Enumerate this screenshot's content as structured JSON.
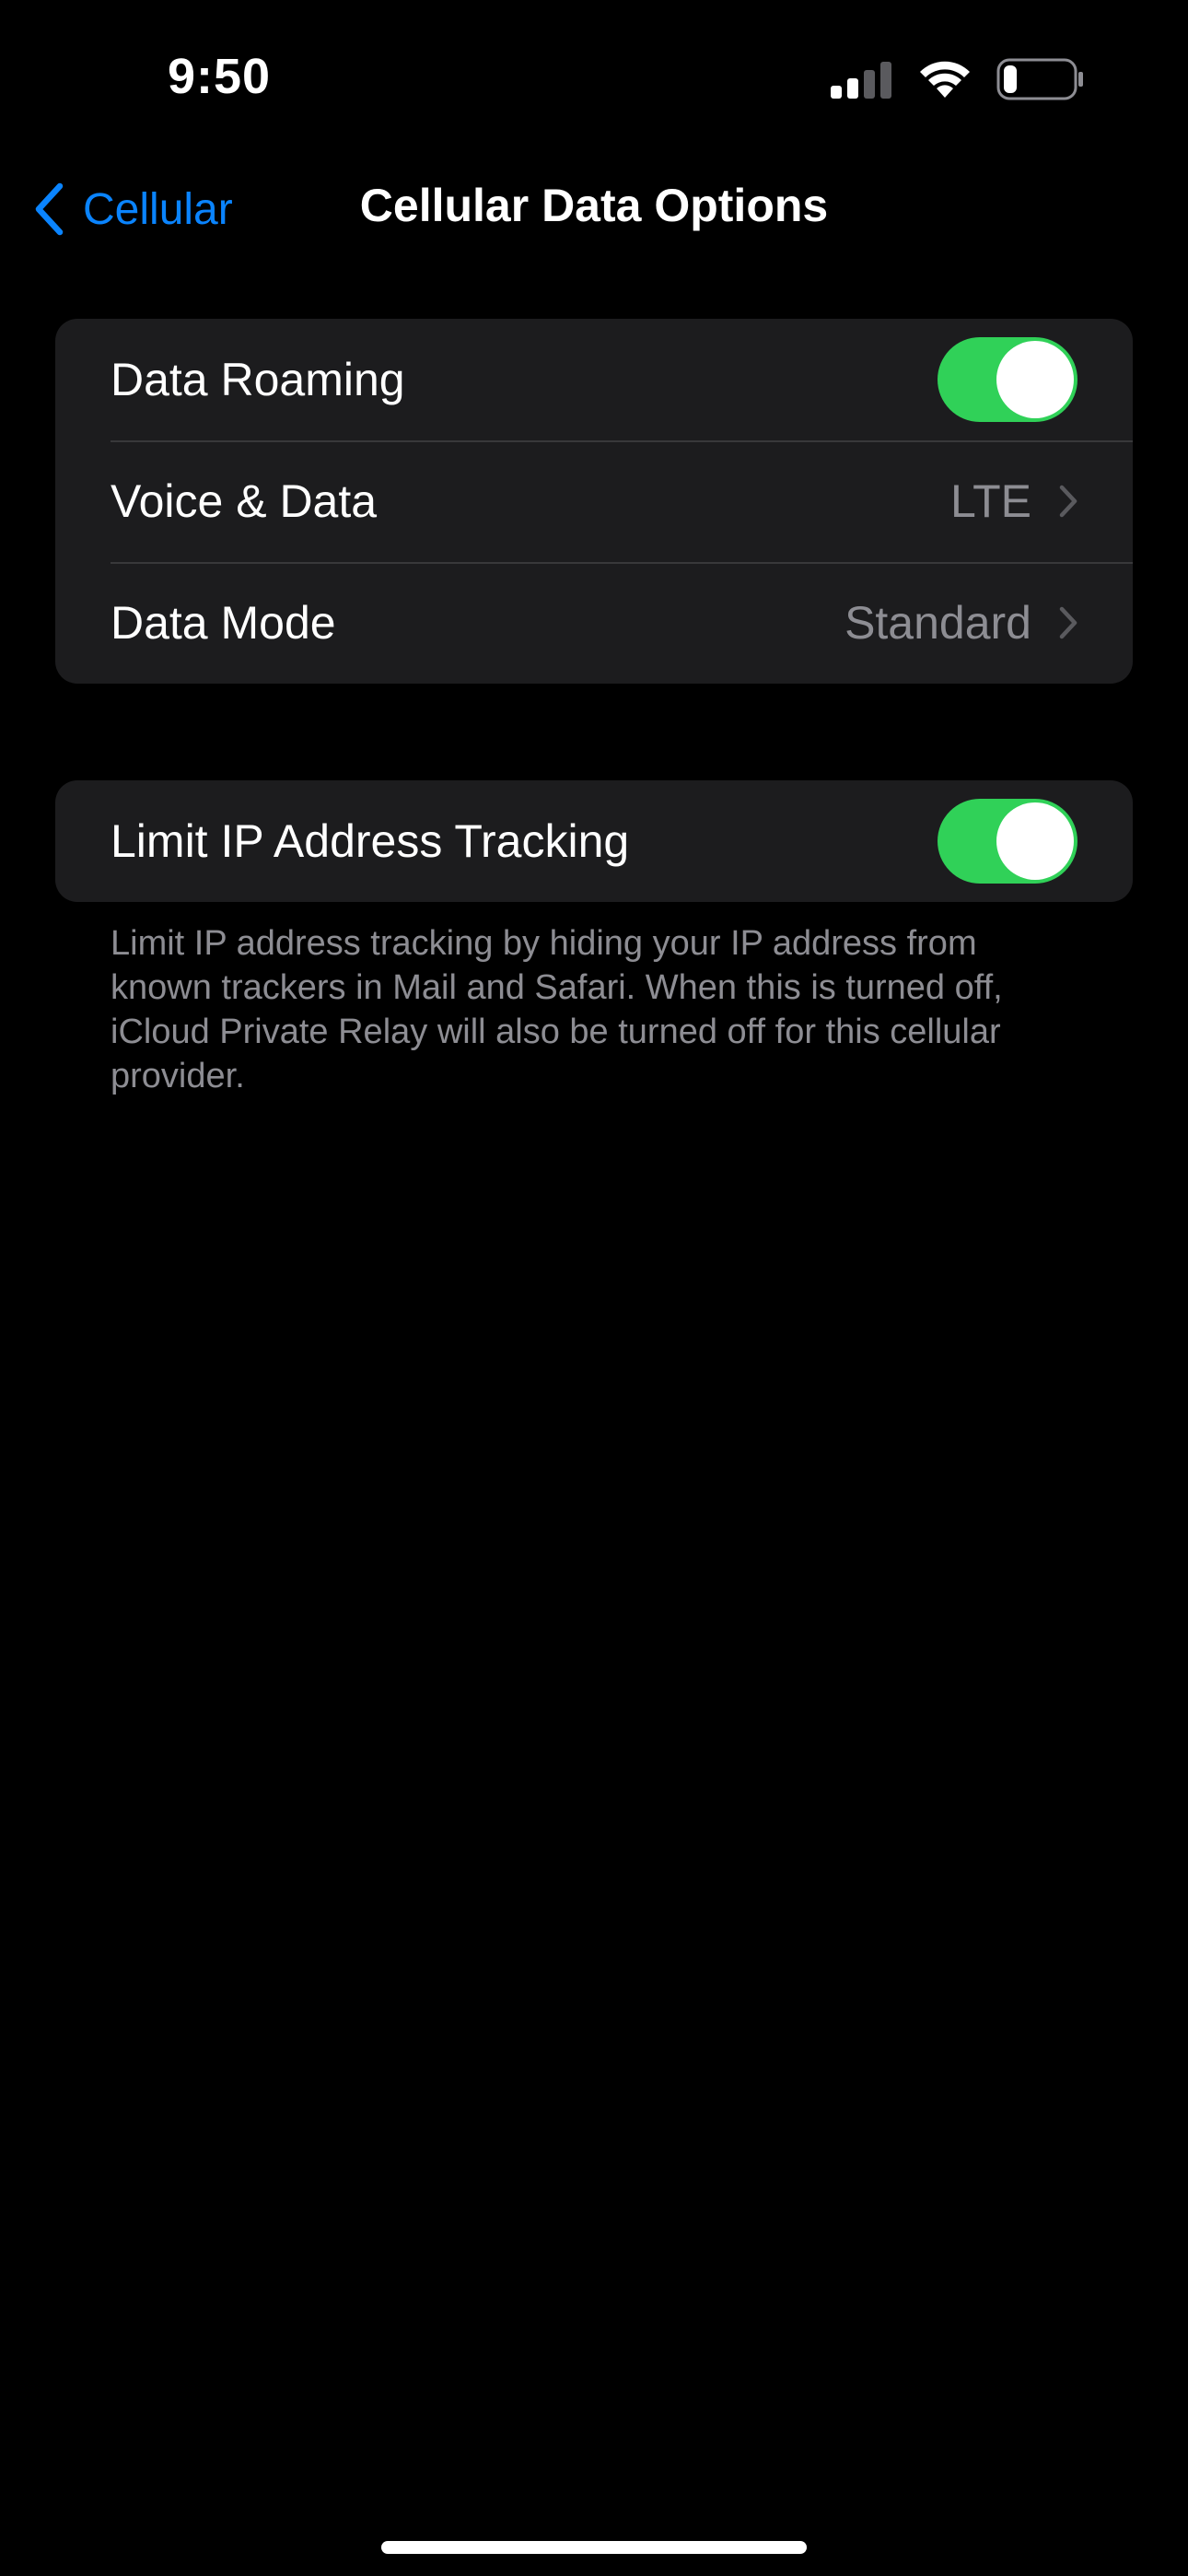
{
  "status_bar": {
    "time": "9:50",
    "signal_icon": "cellular-signal-icon",
    "wifi_icon": "wifi-icon",
    "battery_icon": "battery-icon",
    "battery_level": 0.2
  },
  "nav": {
    "back_label": "Cellular",
    "back_icon": "chevron-left-icon",
    "title": "Cellular Data Options"
  },
  "group1": {
    "data_roaming": {
      "label": "Data Roaming",
      "on": true
    },
    "voice_data": {
      "label": "Voice & Data",
      "value": "LTE"
    },
    "data_mode": {
      "label": "Data Mode",
      "value": "Standard"
    }
  },
  "group2": {
    "limit_ip": {
      "label": "Limit IP Address Tracking",
      "on": true
    },
    "footer": "Limit IP address tracking by hiding your IP address from known trackers in Mail and Safari. When this is turned off, iCloud Private Relay will also be turned off for this cellular provider."
  },
  "colors": {
    "background": "#000000",
    "cell_background": "#1c1c1e",
    "accent": "#0a84ff",
    "toggle_on": "#30d158",
    "secondary_text": "#8d8d93"
  }
}
